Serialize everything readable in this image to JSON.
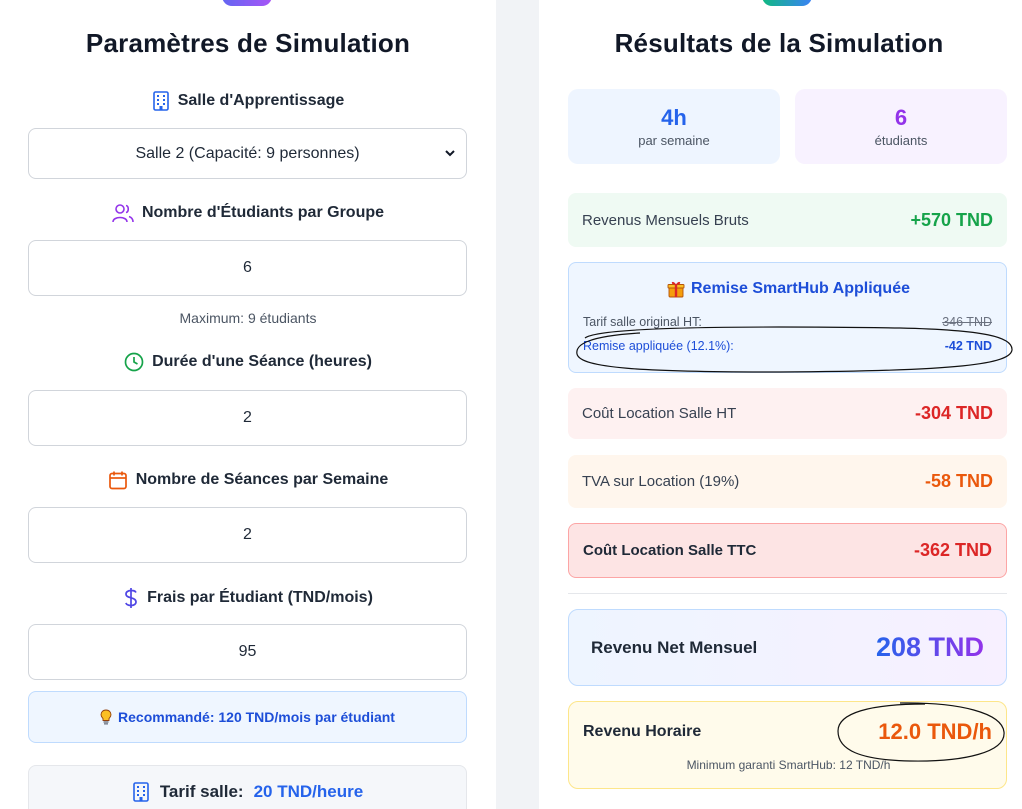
{
  "left": {
    "title": "Paramètres de Simulation",
    "room": {
      "label": "Salle d'Apprentissage",
      "selected": "Salle 2 (Capacité: 9 personnes)"
    },
    "students": {
      "label": "Nombre d'Étudiants par Groupe",
      "value": "6",
      "hint": "Maximum: 9 étudiants"
    },
    "duration": {
      "label": "Durée d'une Séance (heures)",
      "value": "2"
    },
    "sessions": {
      "label": "Nombre de Séances par Semaine",
      "value": "2"
    },
    "fee": {
      "label": "Frais par Étudiant (TND/mois)",
      "value": "95"
    },
    "recommendation": "Recommandé: 120 TND/mois par étudiant",
    "tarif": {
      "label": "Tarif salle:",
      "value": "20 TND/heure"
    }
  },
  "right": {
    "title": "Résultats de la Simulation",
    "stats": [
      {
        "value": "4h",
        "label": "par semaine"
      },
      {
        "value": "6",
        "label": "étudiants"
      }
    ],
    "gross": {
      "label": "Revenus Mensuels Bruts",
      "value": "+570 TND"
    },
    "discount": {
      "title": "Remise SmartHub Appliquée",
      "original_label": "Tarif salle original HT:",
      "original_value": "346 TND",
      "applied_label": "Remise appliquée (12.1%):",
      "applied_value": "-42 TND"
    },
    "room_ht": {
      "label": "Coût Location Salle HT",
      "value": "-304 TND"
    },
    "vat": {
      "label": "TVA sur Location (19%)",
      "value": "-58 TND"
    },
    "room_ttc": {
      "label": "Coût Location Salle TTC",
      "value": "-362 TND"
    },
    "net": {
      "label": "Revenu Net Mensuel",
      "value": "208 TND"
    },
    "hourly": {
      "label": "Revenu Horaire",
      "value": "12.0 TND/h",
      "min": "Minimum garanti SmartHub: 12 TND/h"
    }
  },
  "colors": {
    "accent_blue": "#2563eb",
    "accent_purple": "#9333ea",
    "positive_green": "#16a34a",
    "negative_red": "#dc2626",
    "warning_orange": "#ea580c"
  },
  "icons": [
    "building-icon",
    "users-icon",
    "clock-icon",
    "calendar-icon",
    "dollar-icon",
    "lightbulb-icon",
    "gift-icon",
    "chevron-down-icon"
  ]
}
